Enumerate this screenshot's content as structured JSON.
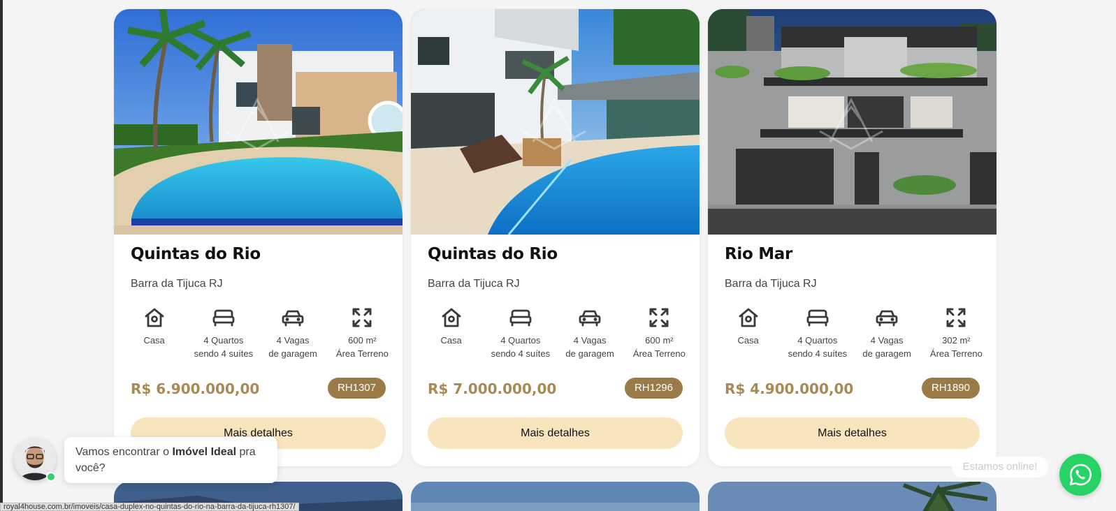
{
  "listings": [
    {
      "title": "Quintas do Rio",
      "location": "Barra da Tijuca RJ",
      "type": "Casa",
      "bedrooms_line1": "4 Quartos",
      "bedrooms_line2": "sendo 4 suítes",
      "parking_line1": "4 Vagas",
      "parking_line2": "de garagem",
      "area_line1": "600 m²",
      "area_line2": "Área Terreno",
      "price": "R$ 6.900.000,00",
      "code": "RH1307",
      "details_label": "Mais detalhes"
    },
    {
      "title": "Quintas do Rio",
      "location": "Barra da Tijuca RJ",
      "type": "Casa",
      "bedrooms_line1": "4 Quartos",
      "bedrooms_line2": "sendo 4 suítes",
      "parking_line1": "4 Vagas",
      "parking_line2": "de garagem",
      "area_line1": "600 m²",
      "area_line2": "Área Terreno",
      "price": "R$ 7.000.000,00",
      "code": "RH1296",
      "details_label": "Mais detalhes"
    },
    {
      "title": "Rio Mar",
      "location": "Barra da Tijuca RJ",
      "type": "Casa",
      "bedrooms_line1": "4 Quartos",
      "bedrooms_line2": "sendo 4 suítes",
      "parking_line1": "4 Vagas",
      "parking_line2": "de garagem",
      "area_line1": "302 m²",
      "area_line2": "Área Terreno",
      "price": "R$ 4.900.000,00",
      "code": "RH1890",
      "details_label": "Mais detalhes"
    }
  ],
  "icons": {
    "type": "house-icon",
    "bedrooms": "bed-icon",
    "parking": "car-icon",
    "area": "expand-arrows-icon"
  },
  "chat": {
    "message_prefix": "Vamos encontrar o ",
    "message_bold": "Imóvel Ideal",
    "message_suffix": " pra você?",
    "status": "Estamos online!",
    "online_dot_color": "#2fd36a"
  },
  "whatsapp": {
    "icon": "whatsapp-icon",
    "color": "#25d366"
  },
  "browser": {
    "status_url": "royal4house.com.br/imoveis/casa-duplex-no-quintas-do-rio-na-barra-da-tijuca-rh1307/"
  },
  "colors": {
    "price": "#a98a54",
    "code_badge": "#9a7b47",
    "button": "#f8e4bd"
  }
}
